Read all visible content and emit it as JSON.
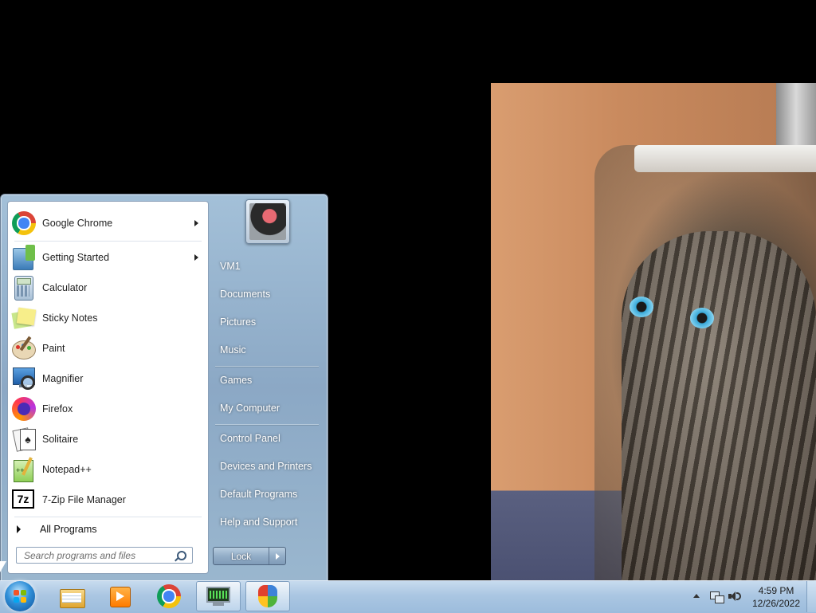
{
  "start_menu": {
    "programs": [
      {
        "label": "Google Chrome",
        "icon": "chrome-icon",
        "has_submenu": true
      },
      {
        "label": "Getting Started",
        "icon": "getting-started-icon",
        "has_submenu": true
      },
      {
        "label": "Calculator",
        "icon": "calculator-icon",
        "has_submenu": false
      },
      {
        "label": "Sticky Notes",
        "icon": "sticky-notes-icon",
        "has_submenu": false
      },
      {
        "label": "Paint",
        "icon": "paint-icon",
        "has_submenu": false
      },
      {
        "label": "Magnifier",
        "icon": "magnifier-icon",
        "has_submenu": false
      },
      {
        "label": "Firefox",
        "icon": "firefox-icon",
        "has_submenu": false
      },
      {
        "label": "Solitaire",
        "icon": "solitaire-icon",
        "has_submenu": false
      },
      {
        "label": "Notepad++",
        "icon": "notepadpp-icon",
        "has_submenu": false
      },
      {
        "label": "7-Zip File Manager",
        "icon": "7zip-icon",
        "has_submenu": false
      }
    ],
    "all_programs_label": "All Programs",
    "search_placeholder": "Search programs and files",
    "right_items": [
      {
        "label": "VM1"
      },
      {
        "label": "Documents"
      },
      {
        "label": "Pictures"
      },
      {
        "label": "Music"
      },
      {
        "label": "Games"
      },
      {
        "label": "My Computer"
      },
      {
        "label": "Control Panel"
      },
      {
        "label": "Devices and Printers"
      },
      {
        "label": "Default Programs"
      },
      {
        "label": "Help and Support"
      }
    ],
    "lock_label": "Lock"
  },
  "taskbar": {
    "pinned": [
      {
        "name": "windows-explorer-icon"
      },
      {
        "name": "media-player-icon"
      },
      {
        "name": "chrome-icon"
      },
      {
        "name": "task-manager-icon"
      },
      {
        "name": "security-shield-icon"
      }
    ],
    "clock_time": "4:59 PM",
    "clock_date": "12/26/2022"
  },
  "colors": {
    "taskbar": "#aac6e2",
    "start_menu": "#a0bcd8",
    "desktop": "#000000"
  }
}
